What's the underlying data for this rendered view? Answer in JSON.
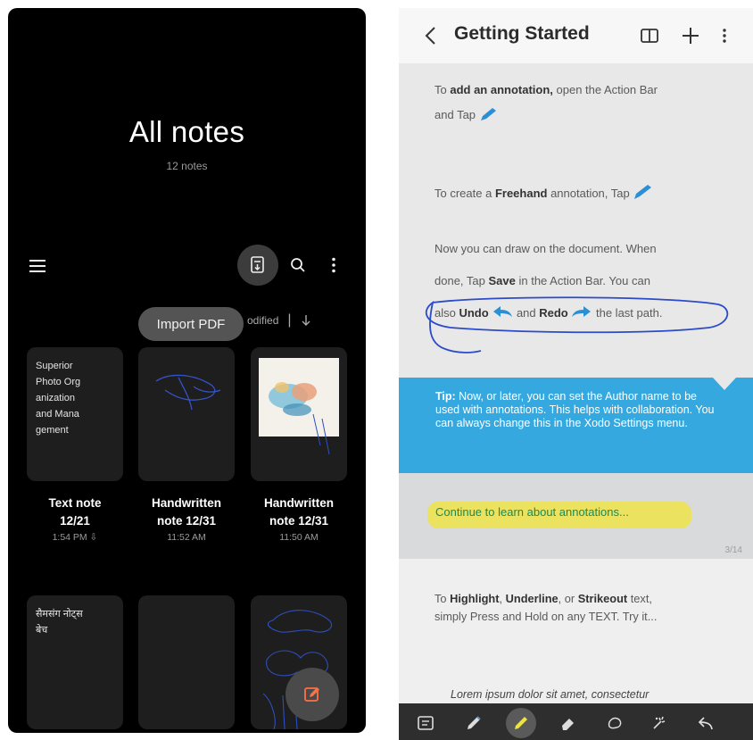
{
  "left_screen": {
    "title": "All notes",
    "note_count": "12 notes",
    "toolbar": {
      "menu_icon": "hamburger-menu-icon",
      "import_icon": "import-pdf-icon",
      "search_icon": "search-icon",
      "more_icon": "more-vertical-icon"
    },
    "tooltip": "Import PDF",
    "sort": {
      "label": "odified",
      "separator": "|",
      "direction_icon": "arrow-down-icon"
    },
    "notes": [
      {
        "preview_text": "Superior\nPhoto Org\nanization\nand Mana\ngement",
        "line1": "Text note",
        "line2": "12/21",
        "line3": "1:54 PM ⇩"
      },
      {
        "preview": "handwriting-sketch",
        "line1": "Handwritten",
        "line2": "note 12/31",
        "line3": "11:52 AM"
      },
      {
        "preview": "watercolor-image",
        "line1": "Handwritten",
        "line2": "note 12/31",
        "line3": "11:50 AM"
      },
      {
        "preview_text": "सैमसंग नोट्स\nबेच"
      },
      {
        "preview": "blank"
      },
      {
        "preview": "blue-doodle"
      }
    ],
    "fab_icon": "new-note-pen-icon",
    "colors": {
      "background": "#000000",
      "card": "#1e1e1e",
      "fab_accent": "#ff7043"
    }
  },
  "right_screen": {
    "header": {
      "back_icon": "chevron-left-icon",
      "title": "Getting Started",
      "book_icon": "book-icon",
      "add_icon": "plus-icon",
      "more_icon": "more-vertical-icon"
    },
    "para1": {
      "a": "To ",
      "b": "add an annotation,",
      "c": " open the Action Bar",
      "d": "and Tap"
    },
    "para2": {
      "a": "To create a ",
      "b": "Freehand",
      "c": " annotation, Tap"
    },
    "para3": {
      "line1": "Now you can draw on the document. When",
      "line2a": "done, Tap ",
      "line2b": "Save",
      "line2c": " in the Action Bar. You can",
      "line3a": "also ",
      "line3b": "Undo",
      "line3c": " and ",
      "line3d": "Redo",
      "line3e": " the last path."
    },
    "tip": {
      "label": "Tip:",
      "text": " Now, or later, you can set the Author name to be used with annotations. This helps with collaboration. You can always change this in the Xodo Settings menu."
    },
    "continue_link": "Continue to learn about annotations...",
    "page_number": "3/14",
    "para4": {
      "a": "To ",
      "b": "Highlight",
      "c": ", ",
      "d": "Underline",
      "e": ", or ",
      "f": "Strikeout",
      "g": " text,",
      "line2": "simply Press and Hold on any TEXT. Try it..."
    },
    "lorem": "Lorem ipsum dolor sit amet, consectetur",
    "toolbar_icons": [
      "text-box-icon",
      "pen-icon",
      "highlighter-icon",
      "eraser-icon",
      "ink-icon",
      "lasso-icon",
      "magic-pen-icon",
      "undo-icon"
    ],
    "colors": {
      "tip_bg": "#35a8e0",
      "highlight": "#f0e43c",
      "link": "#1a8a5a",
      "ink": "#2b4bc8"
    }
  }
}
